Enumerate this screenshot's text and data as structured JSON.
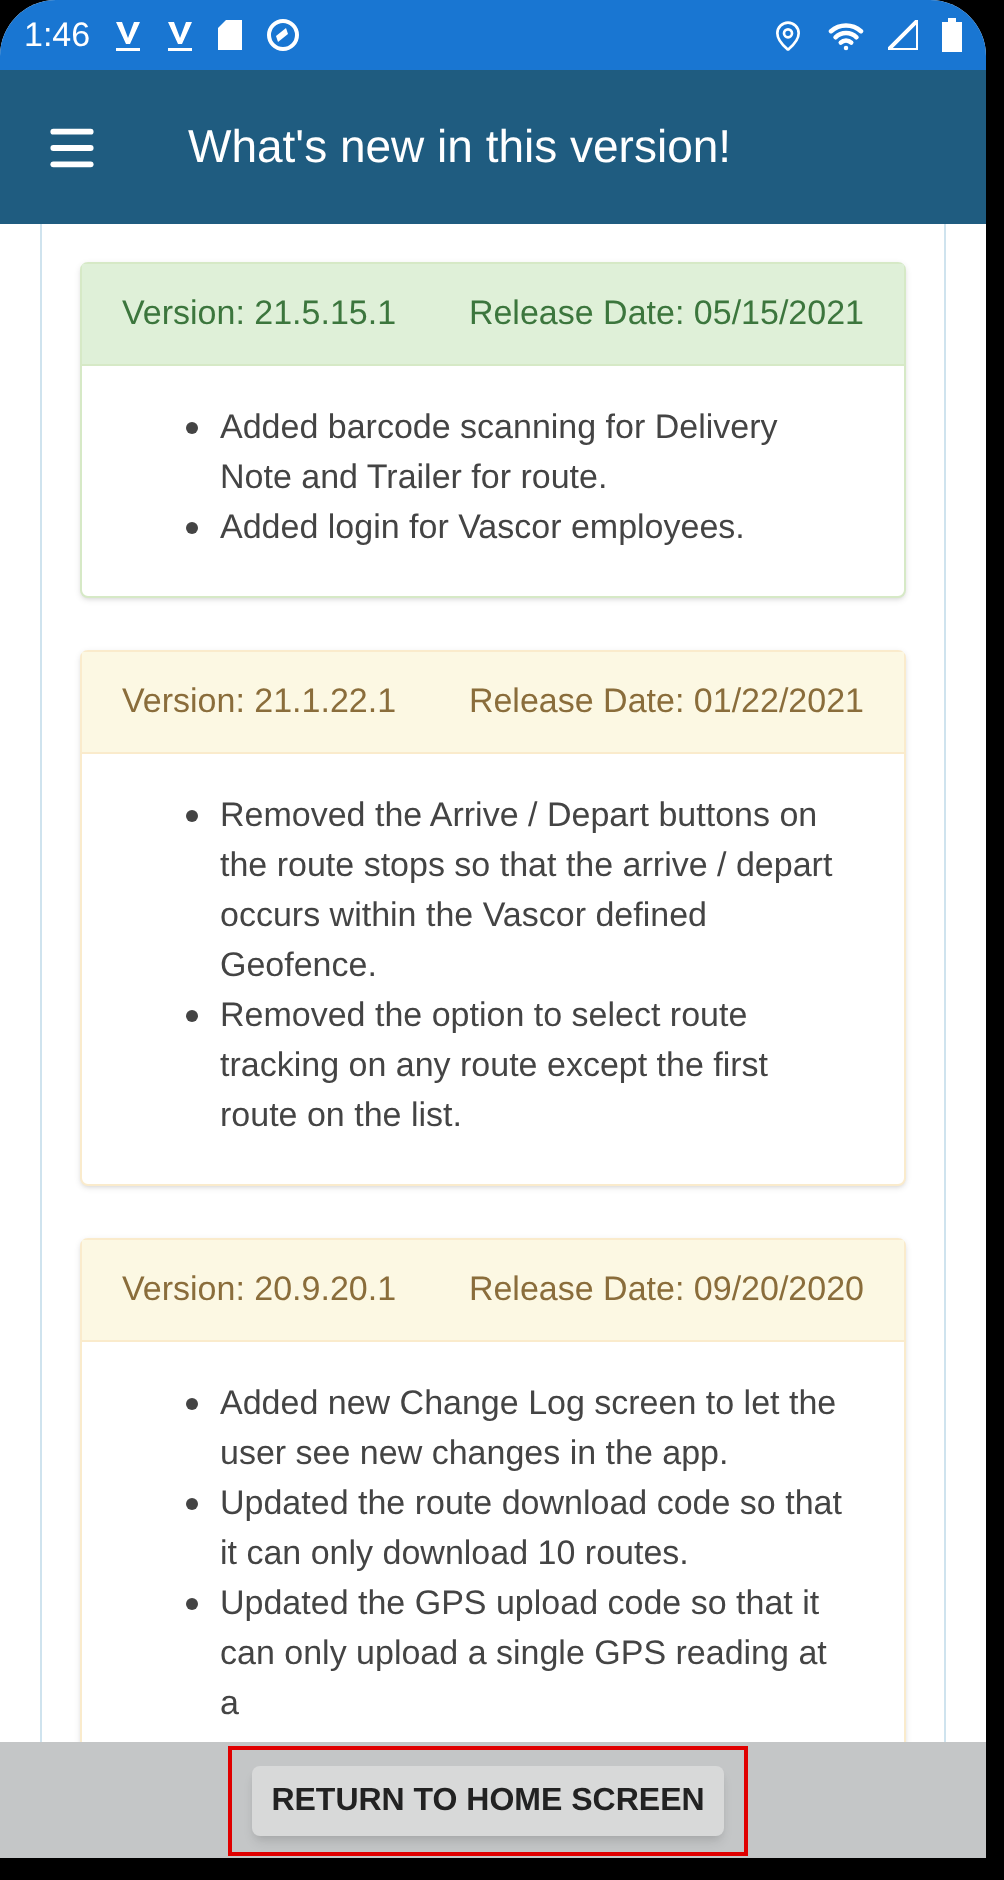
{
  "status_bar": {
    "time": "1:46"
  },
  "app_bar": {
    "title": "What's new in this version!"
  },
  "releases": [
    {
      "kind": "success",
      "version": "Version: 21.5.15.1",
      "date": "Release Date: 05/15/2021",
      "items": [
        "Added barcode scanning for Delivery Note and Trailer for route.",
        "Added login for Vascor employees."
      ]
    },
    {
      "kind": "warning",
      "version": "Version: 21.1.22.1",
      "date": "Release Date: 01/22/2021",
      "items": [
        "Removed the Arrive / Depart buttons on the route stops so that the arrive / depart occurs within the Vascor defined Geofence.",
        "Removed the option to select route tracking on any route except the first route on the list."
      ]
    },
    {
      "kind": "warning",
      "version": "Version: 20.9.20.1",
      "date": "Release Date: 09/20/2020",
      "items": [
        "Added new Change Log screen to let the user see new changes in the app.",
        "Updated the route download code so that it can only download 10 routes.",
        "Updated the GPS upload code so that it can only upload a single GPS reading at a"
      ]
    }
  ],
  "footer": {
    "button": {
      "label": "RETURN TO HOME SCREEN",
      "highlighted": true
    }
  }
}
